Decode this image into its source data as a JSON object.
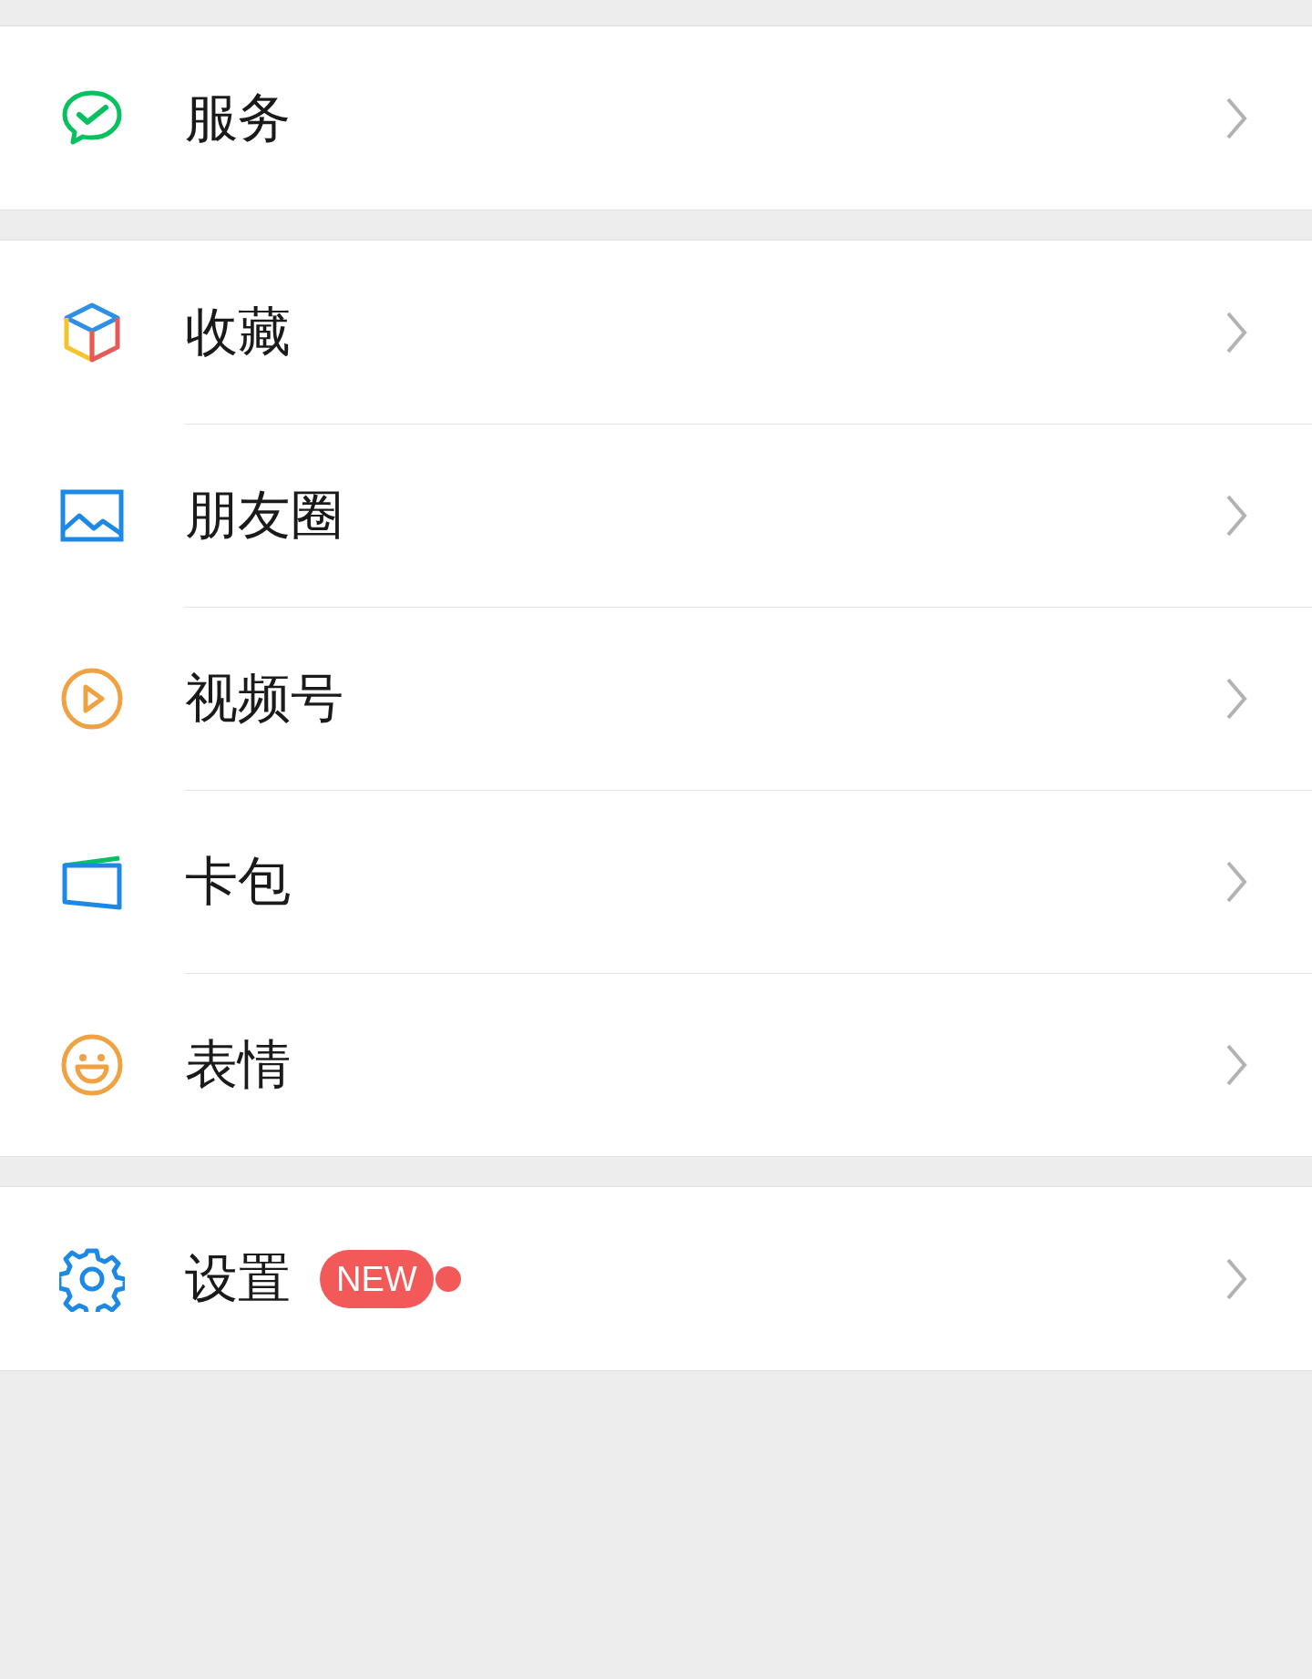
{
  "groups": [
    {
      "items": [
        {
          "label": "服务",
          "kind": "services"
        }
      ]
    },
    {
      "items": [
        {
          "label": "收藏",
          "kind": "favorites"
        },
        {
          "label": "朋友圈",
          "kind": "moments"
        },
        {
          "label": "视频号",
          "kind": "channels"
        },
        {
          "label": "卡包",
          "kind": "cards"
        },
        {
          "label": "表情",
          "kind": "stickers"
        }
      ]
    },
    {
      "items": [
        {
          "label": "设置",
          "kind": "settings",
          "badge": "NEW",
          "dot": true
        }
      ]
    }
  ]
}
